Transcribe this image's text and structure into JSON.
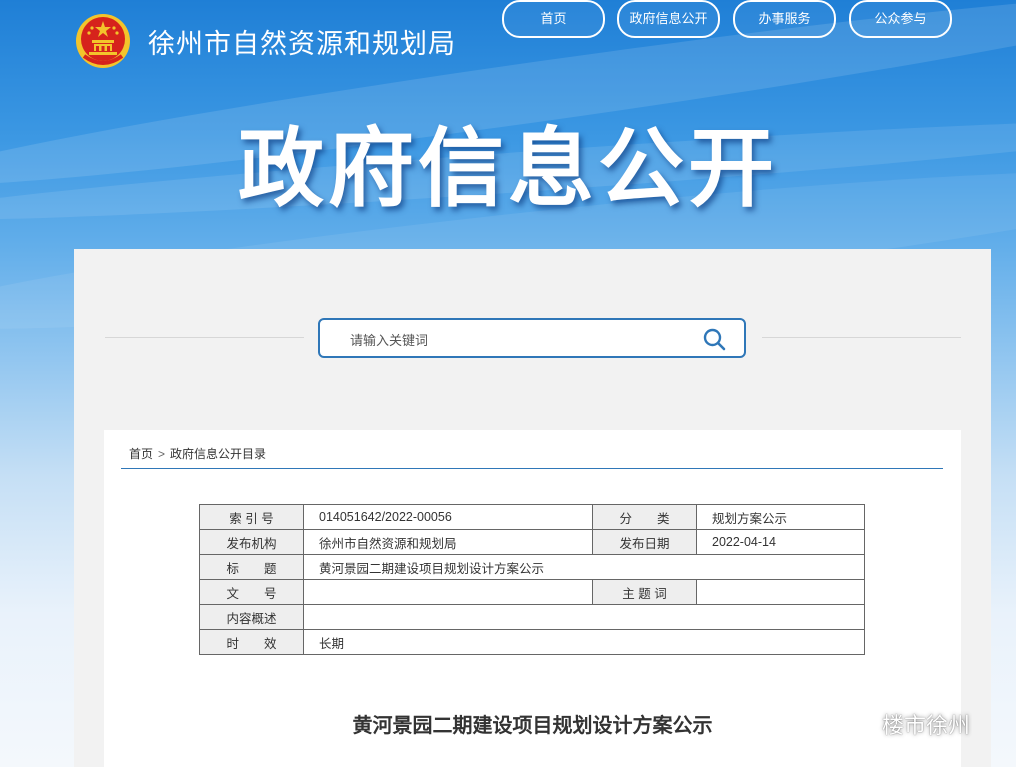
{
  "header": {
    "site_name": "徐州市自然资源和规划局",
    "nav": [
      "首页",
      "政府信息公开",
      "办事服务",
      "公众参与"
    ]
  },
  "hero": {
    "title": "政府信息公开"
  },
  "search": {
    "placeholder": "请输入关键词"
  },
  "breadcrumb": {
    "home": "首页",
    "separator": ">",
    "current": "政府信息公开目录"
  },
  "meta": {
    "index_label": "索 引 号",
    "index_value": "014051642/2022-00056",
    "category_label": "分　　类",
    "category_value": "规划方案公示",
    "publisher_label": "发布机构",
    "publisher_value": "徐州市自然资源和规划局",
    "date_label": "发布日期",
    "date_value": "2022-04-14",
    "title_label": "标　　题",
    "title_value": "黄河景园二期建设项目规划设计方案公示",
    "docno_label": "文　　号",
    "docno_value": "",
    "keyword_label": "主 题 词",
    "keyword_value": "",
    "summary_label": "内容概述",
    "summary_value": "",
    "validity_label": "时　　效",
    "validity_value": "长期"
  },
  "document": {
    "title": "黄河景园二期建设项目规划设计方案公示"
  },
  "watermark": {
    "text": "楼市徐州"
  },
  "colors": {
    "accent": "#2f77b8",
    "banner_top": "#1f7fd6",
    "emblem_red": "#d6231c",
    "emblem_gold": "#f3c42b"
  }
}
